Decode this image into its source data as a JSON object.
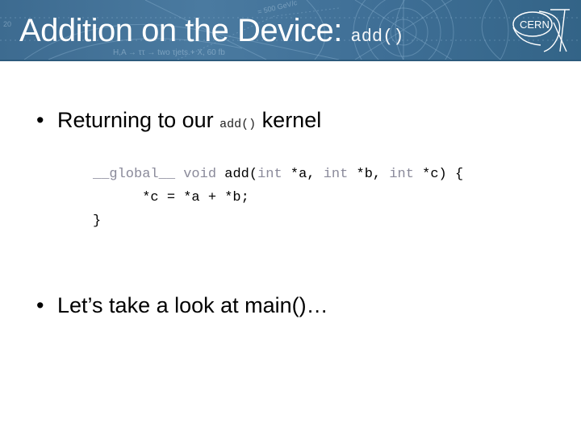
{
  "slide": {
    "title_text": "Addition on the Device:",
    "title_code": "add()",
    "logo_text": "CERN",
    "header_background_labels": [
      "20",
      "= 500 GeV/c",
      "H,A → ττ → two τjets + X, 60 fb"
    ],
    "colors": {
      "header_blue": "#3f6f96",
      "keyword_gray": "#8a8a9a",
      "text": "#000000"
    }
  },
  "bullets": [
    {
      "pre": "Returning to our",
      "code": "add()",
      "post": "kernel"
    },
    {
      "text": "Let’s take a look at main()…"
    }
  ],
  "code_block": {
    "line1": {
      "kw1": "__global__",
      "kw2": "void",
      "fn": "add(",
      "t1": "int",
      "a1": "*a,",
      "t2": "int",
      "a2": "*b,",
      "t3": "int",
      "a3": "*c)",
      "brace": "{"
    },
    "line2": "      *c = *a + *b;",
    "line3": "}"
  }
}
